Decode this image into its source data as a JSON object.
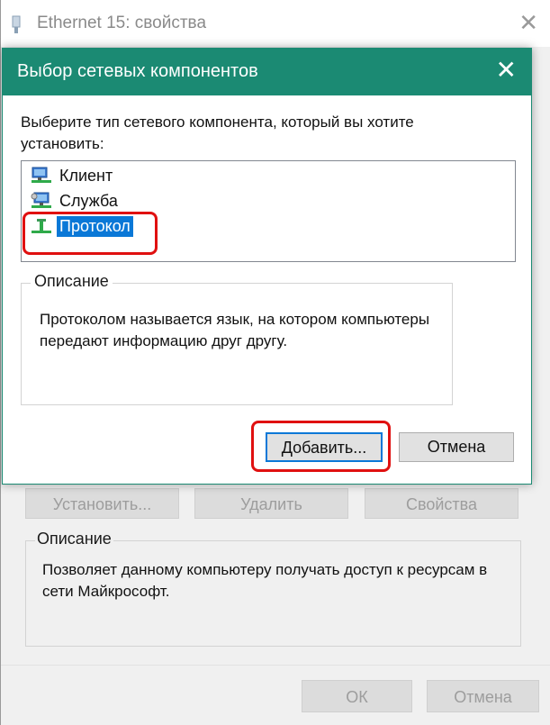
{
  "back_window": {
    "title": "Ethernet 15: свойства",
    "close_glyph": "✕",
    "buttons": {
      "install": "Установить...",
      "remove": "Удалить",
      "properties": "Свойства"
    },
    "description_title": "Описание",
    "description_text": "Позволяет данному компьютеру получать доступ к ресурсам в сети Майкрософт.",
    "ok": "ОК",
    "cancel": "Отмена"
  },
  "dialog": {
    "title": "Выбор сетевых компонентов",
    "close_glyph": "✕",
    "prompt": "Выберите тип сетевого компонента, который вы хотите установить:",
    "list_items": [
      {
        "label": "Клиент",
        "icon": "client-icon"
      },
      {
        "label": "Служба",
        "icon": "service-icon"
      },
      {
        "label": "Протокол",
        "icon": "protocol-icon",
        "selected": true
      }
    ],
    "description_title": "Описание",
    "description_text": "Протоколом называется язык, на котором компьютеры передают информацию друг другу.",
    "add_button": "Добавить...",
    "cancel_button": "Отмена"
  },
  "colors": {
    "dialog_titlebar": "#1b8a73",
    "selection": "#0a78d7",
    "highlight": "#e01010"
  }
}
